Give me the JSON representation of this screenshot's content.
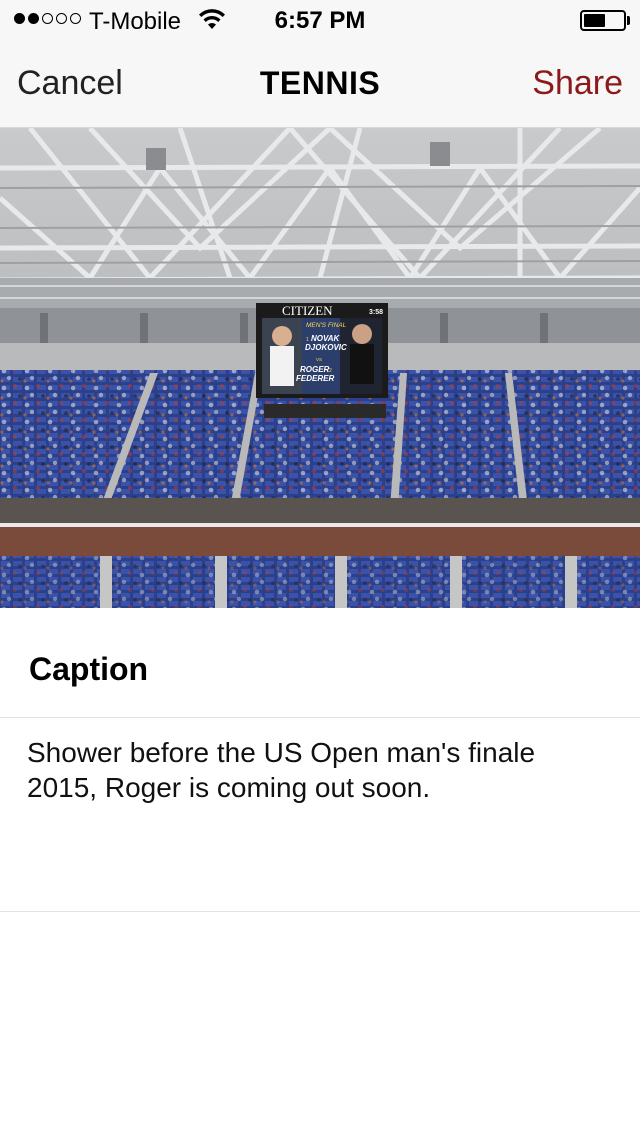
{
  "status_bar": {
    "carrier": "T-Mobile",
    "time": "6:57 PM",
    "signal_bars_filled": 2,
    "signal_bars_total": 5,
    "battery_level": 0.55
  },
  "nav": {
    "cancel_label": "Cancel",
    "title": "TENNIS",
    "share_label": "Share",
    "accent_color": "#8b1a1a"
  },
  "photo": {
    "scoreboard": {
      "brand": "CITIZEN",
      "clock": "3:58",
      "event": "MEN'S FINAL",
      "player1_seed": "1",
      "player1_first": "NOVAK",
      "player1_last": "DJOKOVIC",
      "versus": "VS",
      "player2_first": "ROGER",
      "player2_seed": "2",
      "player2_last": "FEDERER"
    }
  },
  "caption": {
    "label": "Caption",
    "text": "Shower before the US Open man's finale 2015, Roger is coming out soon."
  },
  "icons": {
    "wifi": "wifi-icon",
    "battery": "battery-icon",
    "signal": "signal-dots-icon"
  }
}
